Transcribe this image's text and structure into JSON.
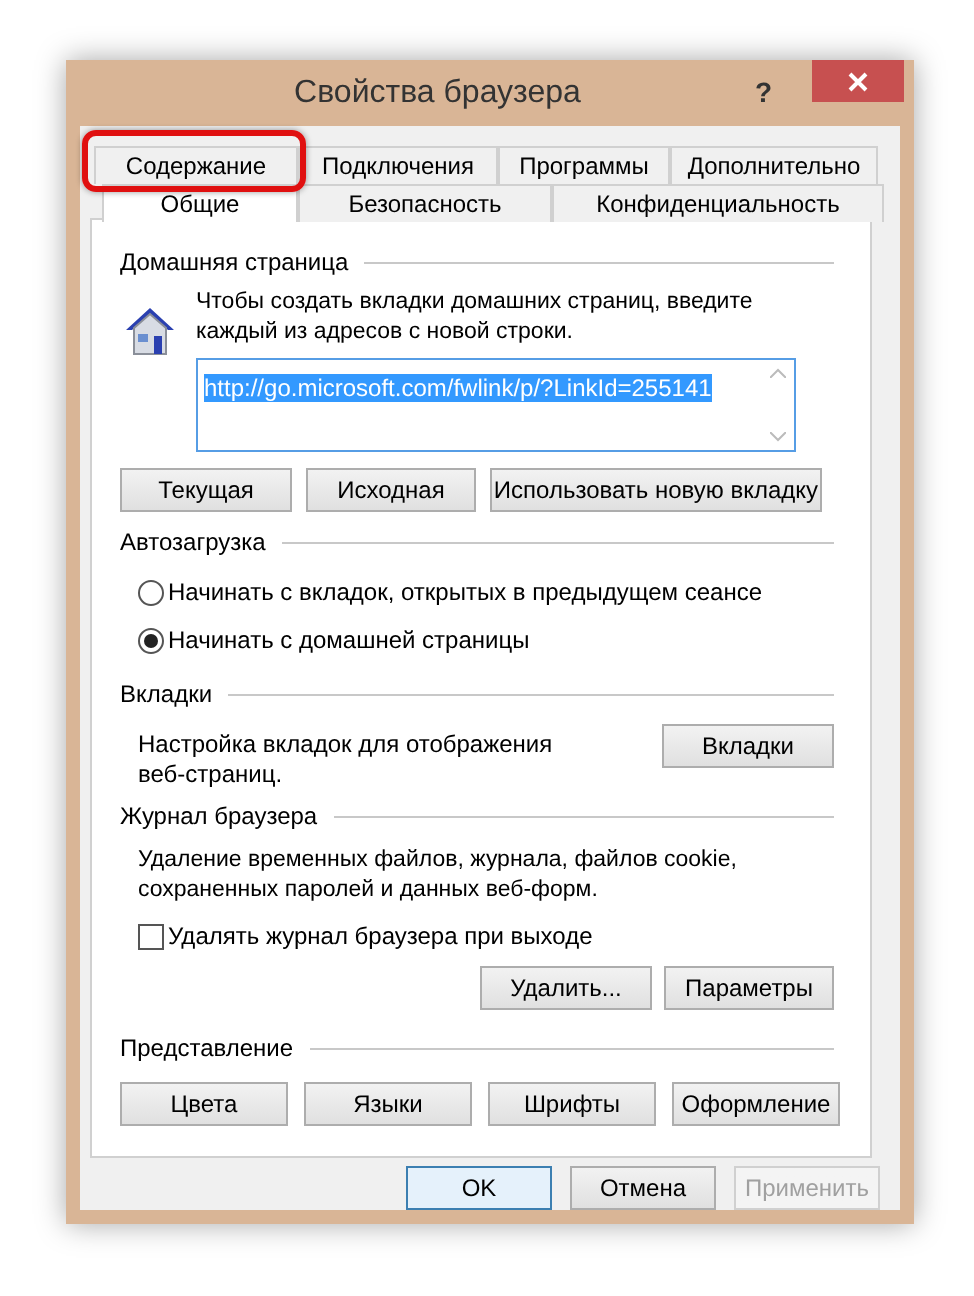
{
  "window": {
    "title": "Свойства браузера",
    "help": "?"
  },
  "tab_rows": [
    {
      "tabs": [
        {
          "label": "Содержание",
          "selected": false,
          "highlighted": true
        },
        {
          "label": "Подключения",
          "selected": false,
          "highlighted": false
        },
        {
          "label": "Программы",
          "selected": false,
          "highlighted": false
        },
        {
          "label": "Дополнительно",
          "selected": false,
          "highlighted": false
        }
      ]
    },
    {
      "tabs": [
        {
          "label": "Общие",
          "selected": true,
          "highlighted": false
        },
        {
          "label": "Безопасность",
          "selected": false,
          "highlighted": false
        },
        {
          "label": "Конфиденциальность",
          "selected": false,
          "highlighted": false
        }
      ]
    }
  ],
  "home_page": {
    "title": "Домашняя страница",
    "description": "Чтобы создать вкладки домашних страниц, введите каждый из адресов с новой строки.",
    "url": "http://go.microsoft.com/fwlink/p/?LinkId=255141",
    "buttons": [
      "Текущая",
      "Исходная",
      "Использовать новую вкладку"
    ]
  },
  "startup": {
    "title": "Автозагрузка",
    "options": [
      {
        "label": "Начинать с вкладок, открытых в предыдущем сеансе",
        "selected": false
      },
      {
        "label": "Начинать с домашней страницы",
        "selected": true
      }
    ]
  },
  "tabs_section": {
    "title": "Вкладки",
    "description": "Настройка вкладок для отображения веб-страниц.",
    "button": "Вкладки"
  },
  "history": {
    "title": "Журнал браузера",
    "description": "Удаление временных файлов, журнала, файлов cookie, сохраненных паролей и данных веб-форм.",
    "checkbox": {
      "label": "Удалять журнал браузера при выходе",
      "checked": false
    },
    "buttons": [
      "Удалить...",
      "Параметры"
    ]
  },
  "appearance": {
    "title": "Представление",
    "buttons": [
      "Цвета",
      "Языки",
      "Шрифты",
      "Оформление"
    ]
  },
  "footer": {
    "buttons": [
      {
        "label": "OK",
        "default": true,
        "disabled": false
      },
      {
        "label": "Отмена",
        "default": false,
        "disabled": false
      },
      {
        "label": "Применить",
        "default": false,
        "disabled": true
      }
    ]
  }
}
